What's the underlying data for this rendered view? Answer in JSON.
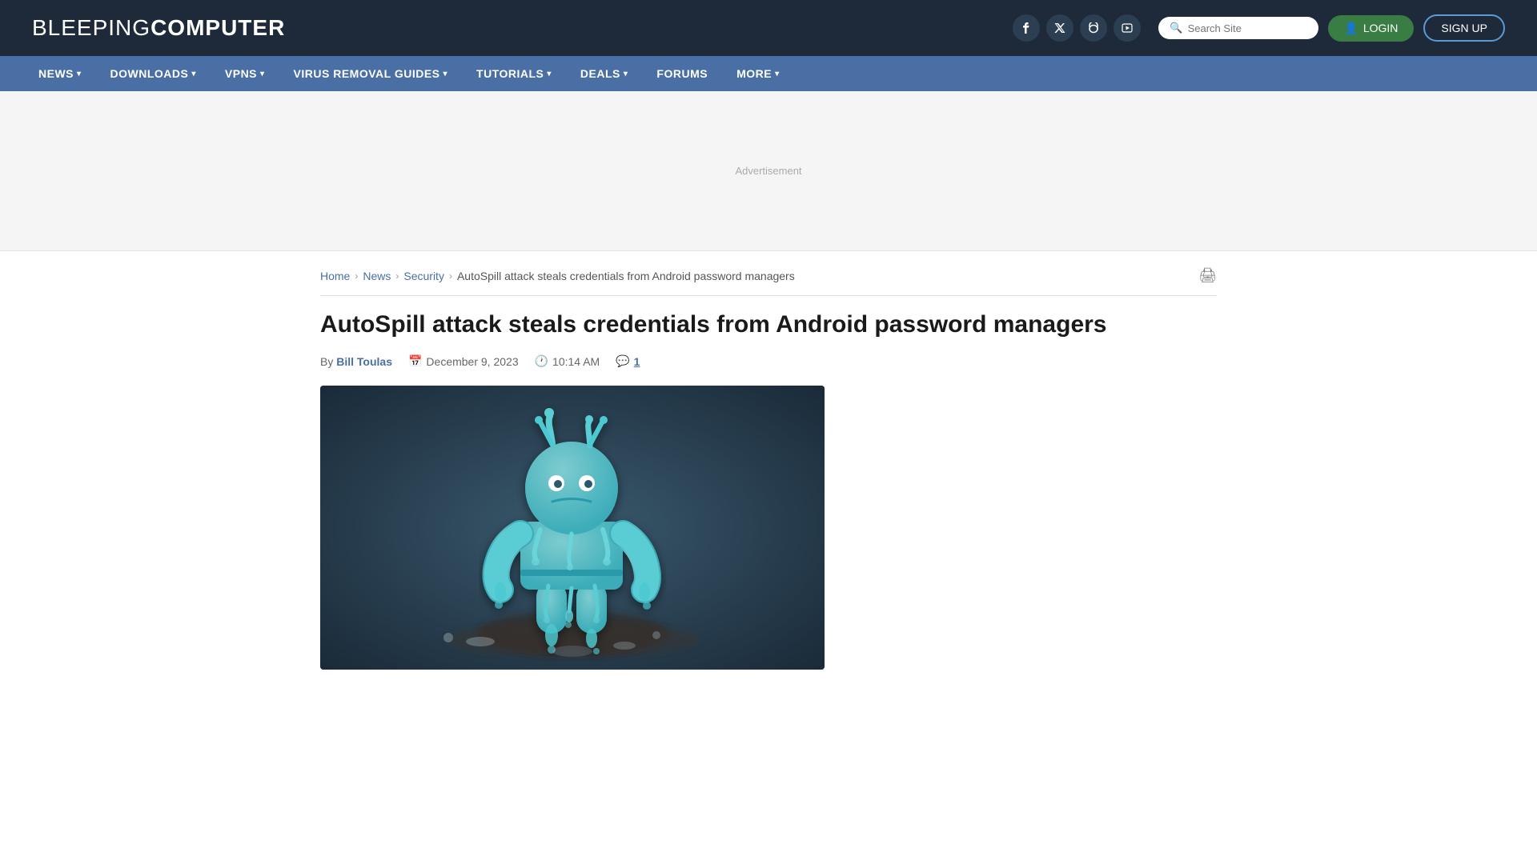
{
  "header": {
    "logo_light": "BLEEPING",
    "logo_bold": "COMPUTER",
    "search_placeholder": "Search Site",
    "login_label": "LOGIN",
    "signup_label": "SIGN UP",
    "social_icons": [
      {
        "name": "facebook",
        "symbol": "f"
      },
      {
        "name": "twitter",
        "symbol": "𝕏"
      },
      {
        "name": "mastodon",
        "symbol": "M"
      },
      {
        "name": "youtube",
        "symbol": "▶"
      }
    ]
  },
  "nav": {
    "items": [
      {
        "label": "NEWS",
        "has_dropdown": true
      },
      {
        "label": "DOWNLOADS",
        "has_dropdown": true
      },
      {
        "label": "VPNS",
        "has_dropdown": true
      },
      {
        "label": "VIRUS REMOVAL GUIDES",
        "has_dropdown": true
      },
      {
        "label": "TUTORIALS",
        "has_dropdown": true
      },
      {
        "label": "DEALS",
        "has_dropdown": true
      },
      {
        "label": "FORUMS",
        "has_dropdown": false
      },
      {
        "label": "MORE",
        "has_dropdown": true
      }
    ]
  },
  "breadcrumb": {
    "items": [
      {
        "label": "Home",
        "href": "#"
      },
      {
        "label": "News",
        "href": "#"
      },
      {
        "label": "Security",
        "href": "#"
      }
    ],
    "current": "AutoSpill attack steals credentials from Android password managers"
  },
  "article": {
    "title": "AutoSpill attack steals credentials from Android password managers",
    "author_prefix": "By",
    "author_name": "Bill Toulas",
    "date": "December 9, 2023",
    "time": "10:14 AM",
    "comment_count": "1",
    "image_alt": "Android robot melting with water dripping"
  }
}
